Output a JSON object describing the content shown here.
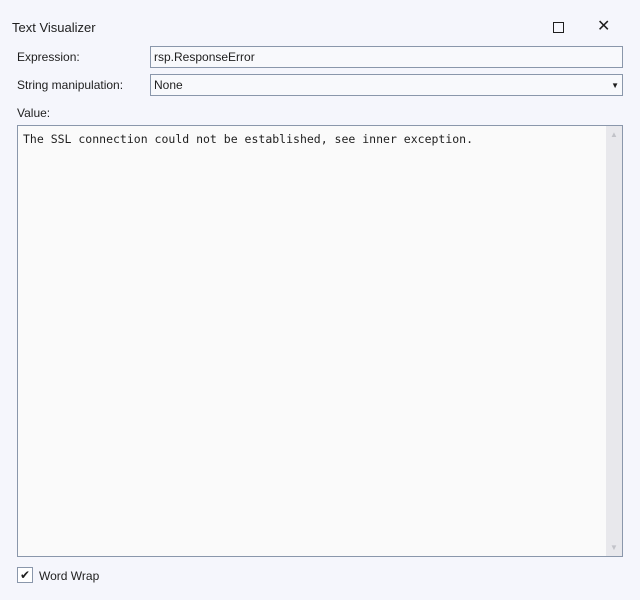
{
  "window": {
    "title": "Text Visualizer"
  },
  "form": {
    "expression_label": "Expression:",
    "expression_value": "rsp.ResponseError",
    "string_manip_label": "String manipulation:",
    "string_manip_value": "None",
    "value_label": "Value:",
    "value_text": "The SSL connection could not be established, see inner exception."
  },
  "options": {
    "word_wrap_label": "Word Wrap",
    "word_wrap_checked": true
  }
}
